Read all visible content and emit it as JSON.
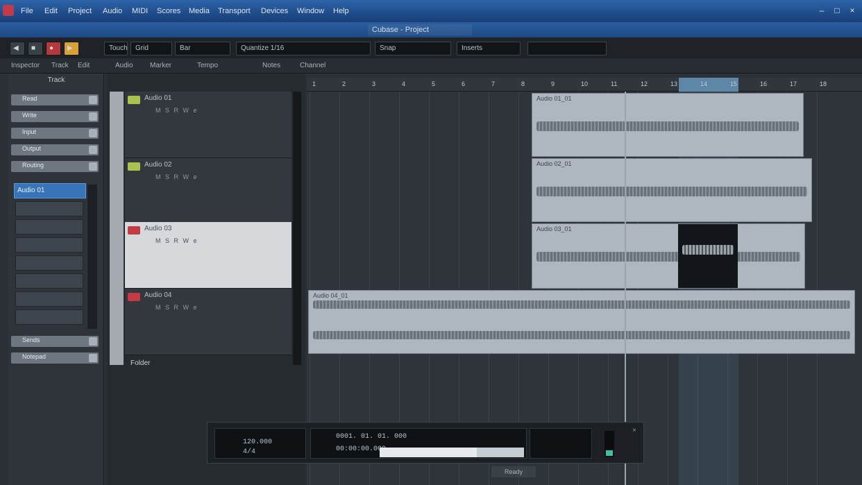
{
  "titlebar": {
    "menu": [
      "File",
      "Edit",
      "Project",
      "Audio",
      "MIDI",
      "Scores",
      "Media",
      "Transport",
      "Devices",
      "Window",
      "Help"
    ],
    "doc_title": "Cubase - Project",
    "win_buttons": [
      "–",
      "□",
      "×"
    ]
  },
  "toolbar": {
    "fields": [
      "Touch",
      "Grid",
      "Bar",
      "Quantize 1/16",
      "Snap",
      "Inserts"
    ],
    "buttons": [
      "◀",
      "■",
      "●",
      "▶"
    ]
  },
  "subbar": {
    "items": [
      "Inspector",
      "Track",
      "Edit",
      "Audio",
      "Marker",
      "Tempo",
      "Notes",
      "Channel"
    ]
  },
  "inspector": {
    "header": "Track",
    "rows": [
      "Read",
      "Write",
      "Input",
      "Output",
      "Routing"
    ],
    "selected": "Audio 01",
    "slots": [
      "",
      "",
      "",
      "",
      "",
      "",
      "",
      ""
    ],
    "footer_rows": [
      "Sends",
      "Notepad"
    ]
  },
  "tracks": [
    {
      "name": "Audio 01",
      "controls": "M S R W e",
      "color": "green",
      "selected": false
    },
    {
      "name": "Audio 02",
      "controls": "M S R W e",
      "color": "green",
      "selected": false
    },
    {
      "name": "Audio 03",
      "controls": "M S R W e",
      "color": "red",
      "selected": true
    },
    {
      "name": "Audio 04",
      "controls": "M S R W e",
      "color": "red",
      "selected": false
    }
  ],
  "folder_label": "Folder",
  "ruler": {
    "bars": [
      "1",
      "2",
      "3",
      "4",
      "5",
      "6",
      "7",
      "8",
      "9",
      "10",
      "11",
      "12",
      "13",
      "14",
      "15",
      "16",
      "17",
      "18"
    ]
  },
  "clips": [
    {
      "name": "Audio 01_01"
    },
    {
      "name": "Audio 02_01"
    },
    {
      "name": "Audio 03_01"
    },
    {
      "name": "Audio 04_01"
    }
  ],
  "transport": {
    "time_primary": "0001. 01. 01. 000",
    "time_secondary": "00:00:00.000",
    "tempo": "120.000",
    "signature": "4/4",
    "status": "Ready"
  }
}
